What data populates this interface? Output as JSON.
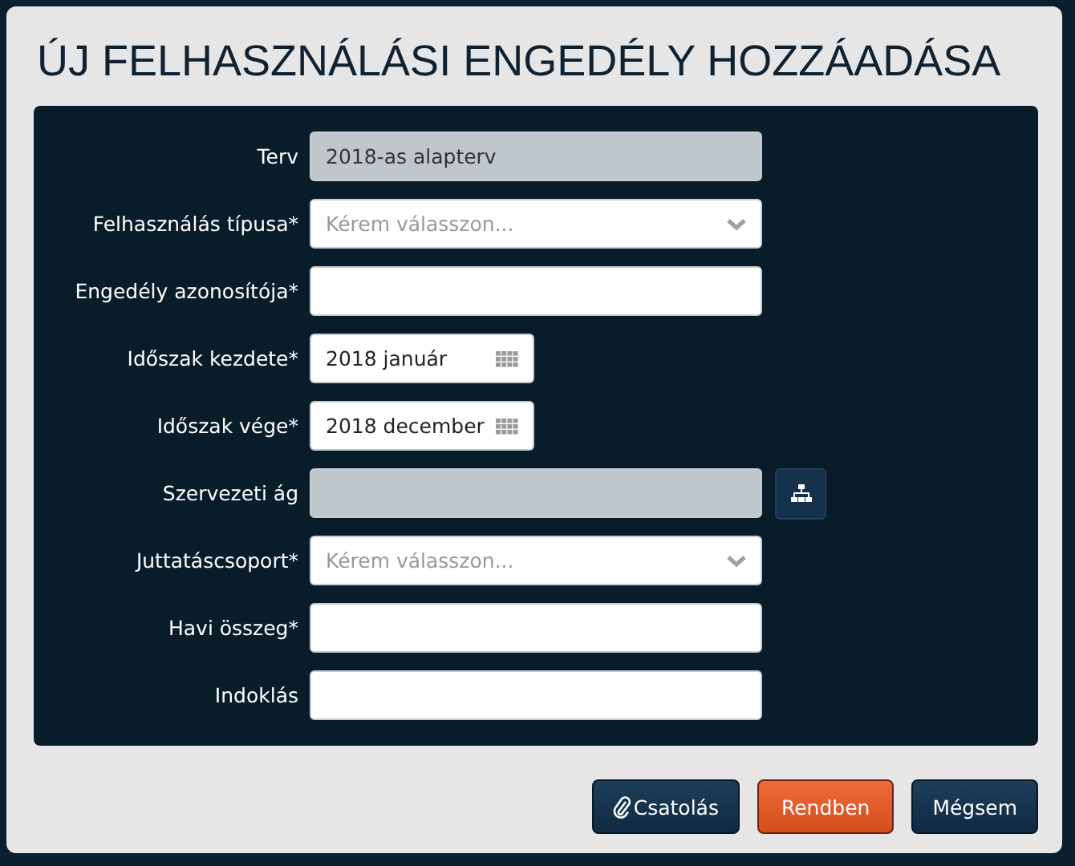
{
  "window": {
    "title": "ÚJ FELHASZNÁLÁSI ENGEDÉLY HOZZÁADÁSA"
  },
  "fields": [
    {
      "label": "Terv",
      "kind": "readonly",
      "value": "2018-as alapterv"
    },
    {
      "label": "Felhasználás típusa*",
      "kind": "select",
      "placeholder": "Kérem válasszon..."
    },
    {
      "label": "Engedély azonosítója*",
      "kind": "text"
    },
    {
      "label": "Időszak kezdete*",
      "kind": "date",
      "value": "2018 január"
    },
    {
      "label": "Időszak vége*",
      "kind": "date",
      "value": "2018 december"
    },
    {
      "label": "Szervezeti ág",
      "kind": "tree"
    },
    {
      "label": "Juttatáscsoport*",
      "kind": "select",
      "placeholder": "Kérem válasszon..."
    },
    {
      "label": "Havi összeg*",
      "kind": "text"
    },
    {
      "label": "Indoklás",
      "kind": "text"
    }
  ],
  "buttons": [
    {
      "label": "Csatolás",
      "kind": "attach"
    },
    {
      "label": "Rendben",
      "kind": "primary"
    },
    {
      "label": "Mégsem",
      "kind": "default"
    }
  ]
}
